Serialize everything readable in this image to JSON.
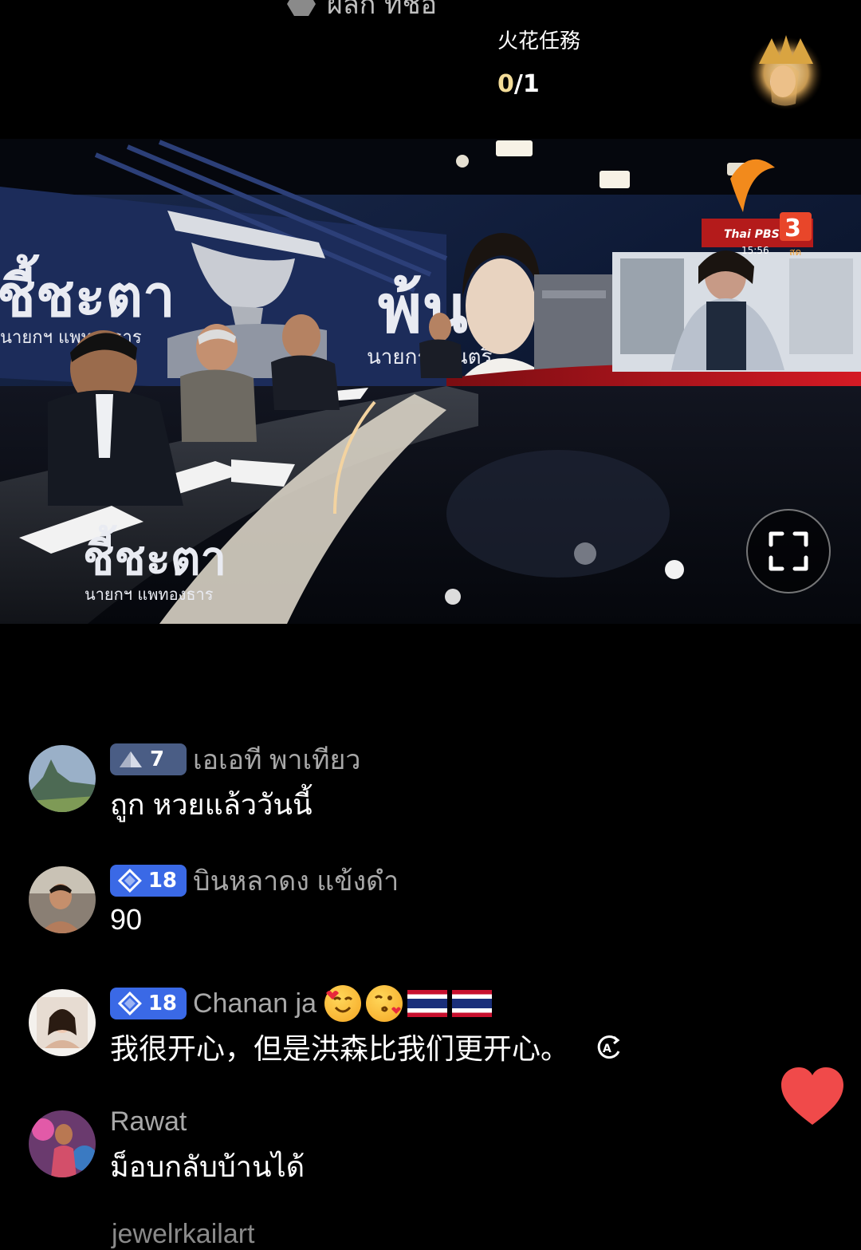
{
  "top_cut_text": "ผลัก ที่ชื่อ",
  "spark_task": {
    "title": "火花任務",
    "current": "0",
    "separator": "/",
    "total": "1"
  },
  "video": {
    "channel_logo": "Thai PBS",
    "channel_number": "3",
    "time": "15:56",
    "show_title": "ชี้ชะตา",
    "show_subtitle": "นายกฯ แพทองธาร",
    "screen_headline": "พ้น",
    "screen_subline": "นายกรัฐมนตรี",
    "channel_sub": "สด"
  },
  "comments": [
    {
      "badge_level": "7",
      "badge_style": "gray",
      "username": "เอเอที พาเทียว",
      "text": "ถูก หวยแล้ววันนี้",
      "avatar_icon": "landscape-avatar"
    },
    {
      "badge_level": "18",
      "badge_style": "blue",
      "username": "บินหลาดง แข้งดำ",
      "text": "90",
      "avatar_icon": "person-avatar"
    },
    {
      "badge_level": "18",
      "badge_style": "blue",
      "username": "Chanan ja",
      "text": "我很开心，但是洪森比我们更开心。",
      "avatar_icon": "person-avatar"
    },
    {
      "username": "Rawat",
      "text": "ม็อบกลับบ้านได้",
      "avatar_icon": "person-avatar"
    }
  ],
  "bottom_cut_text": "jewelrkailart",
  "colors": {
    "background": "#000000",
    "badge_gray": "#4a5d85",
    "badge_blue": "#3a69e6",
    "heart": "#f04a4a",
    "progress_current": "#f3dc98"
  }
}
